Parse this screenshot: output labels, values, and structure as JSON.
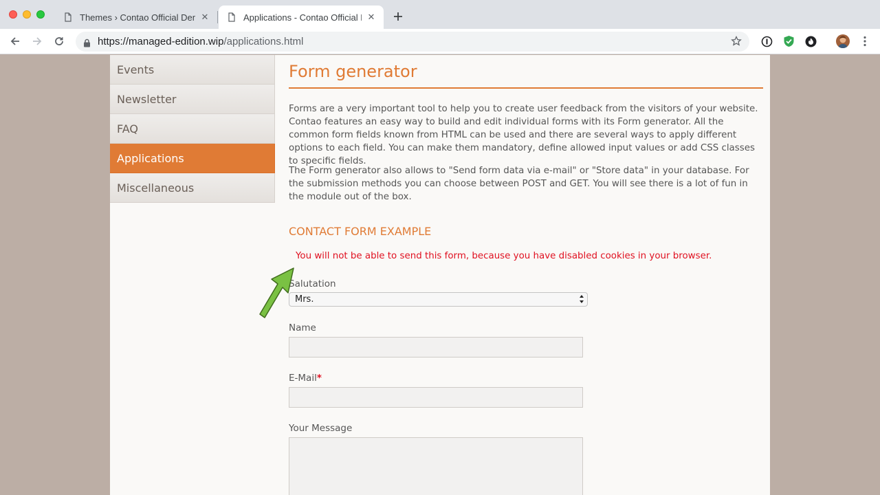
{
  "browser": {
    "tabs": [
      {
        "title": "Themes › Contao Official Demo",
        "active": false
      },
      {
        "title": "Applications - Contao Official Demo",
        "active": true
      }
    ],
    "url": {
      "host": "https://managed-edition.wip",
      "path": "/applications.html"
    }
  },
  "sidebar": {
    "items": [
      {
        "label": "Events",
        "active": false
      },
      {
        "label": "Newsletter",
        "active": false
      },
      {
        "label": "FAQ",
        "active": false
      },
      {
        "label": "Applications",
        "active": true
      },
      {
        "label": "Miscellaneous",
        "active": false
      }
    ]
  },
  "content": {
    "title": "Form generator",
    "paragraph1": "Forms are a very important tool to help you to create user feedback from the visitors of your website. Contao features an easy way to build and edit individual forms with its Form generator. All the common form fields known from HTML can be used and there are several ways to apply different options to each field. You can make them mandatory, define allowed input values or add CSS classes to specific fields.",
    "paragraph2": "The Form generator also allows to \"Send form data via e-mail\" or \"Store data\" in your database. For the submission methods you can choose between POST and GET. You will see there is a lot of fun in the module out of the box.",
    "form_heading": "CONTACT FORM EXAMPLE",
    "error_message": "You will not be able to send this form, because you have disabled cookies in your browser.",
    "form": {
      "salutation_label": "Salutation",
      "salutation_value": "Mrs.",
      "name_label": "Name",
      "name_value": "",
      "email_label": "E-Mail",
      "email_required_mark": "*",
      "email_value": "",
      "message_label": "Your Message",
      "message_value": ""
    }
  },
  "colors": {
    "accent": "#e07b35",
    "error": "#e01020",
    "annotation_arrow": "#7ac143"
  }
}
